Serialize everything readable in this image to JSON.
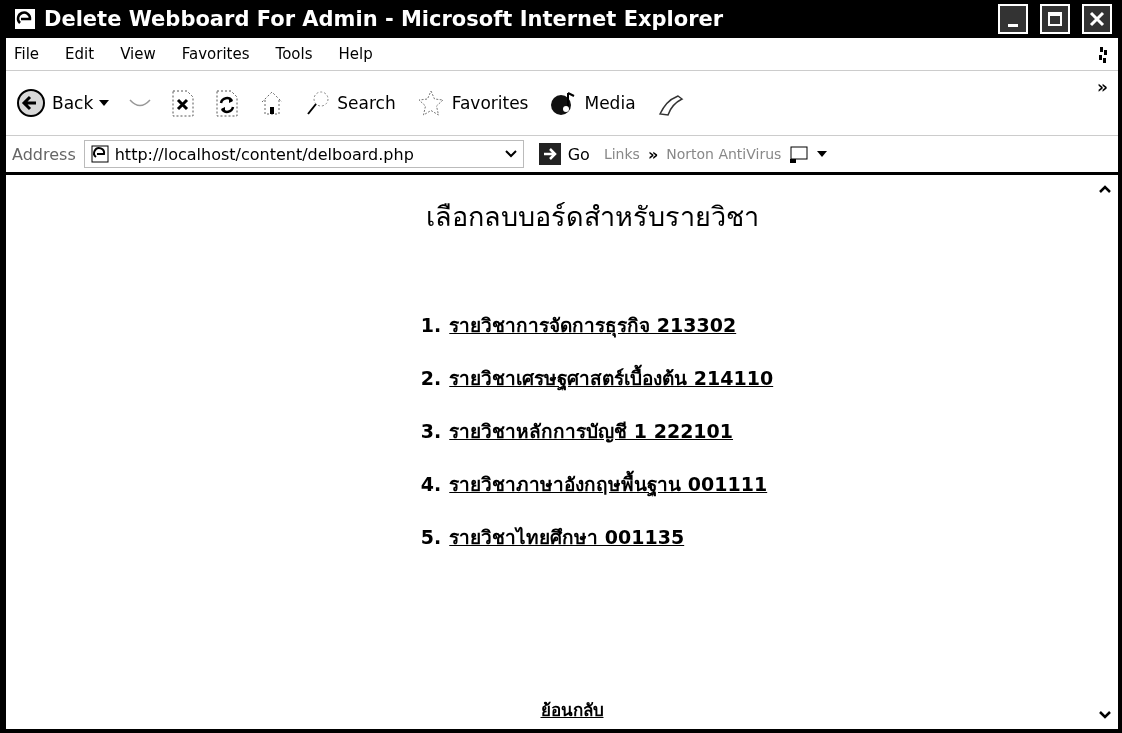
{
  "window": {
    "title": "Delete Webboard For Admin - Microsoft Internet Explorer"
  },
  "menu": [
    "File",
    "Edit",
    "View",
    "Favorites",
    "Tools",
    "Help"
  ],
  "toolbar": {
    "buttons": [
      {
        "kind": "back",
        "label": "Back",
        "disabled": false
      },
      {
        "kind": "forward",
        "disabled": true
      },
      {
        "kind": "stop",
        "disabled": false
      },
      {
        "kind": "refresh",
        "disabled": false
      },
      {
        "kind": "home",
        "disabled": false
      },
      {
        "kind": "search",
        "label": "Search",
        "disabled": false
      },
      {
        "kind": "favorites",
        "label": "Favorites",
        "disabled": false
      },
      {
        "kind": "media",
        "label": "Media",
        "disabled": false
      },
      {
        "kind": "history",
        "disabled": false
      }
    ],
    "chevron": "»"
  },
  "address_bar": {
    "label": "Address",
    "value": "http://localhost/content/delboard.php",
    "go": "Go",
    "links": "Links",
    "links_chevron": "»",
    "extra_toolbar": "Norton AntiVirus"
  },
  "page": {
    "heading": "เลือกลบบอร์ดสำหรับรายวิชา",
    "items": [
      {
        "number": "1.",
        "label": "รายวิชาการจัดการธุรกิจ 213302"
      },
      {
        "number": "2.",
        "label": "รายวิชาเศรษฐศาสตร์เบื้องต้น 214110"
      },
      {
        "number": "3.",
        "label": "รายวิชาหลักการบัญชี 1 222101"
      },
      {
        "number": "4.",
        "label": "รายวิชาภาษาอังกฤษพื้นฐาน 001111"
      },
      {
        "number": "5.",
        "label": "รายวิชาไทยศึกษา 001135"
      }
    ],
    "back_link": "ย้อนกลับ"
  }
}
